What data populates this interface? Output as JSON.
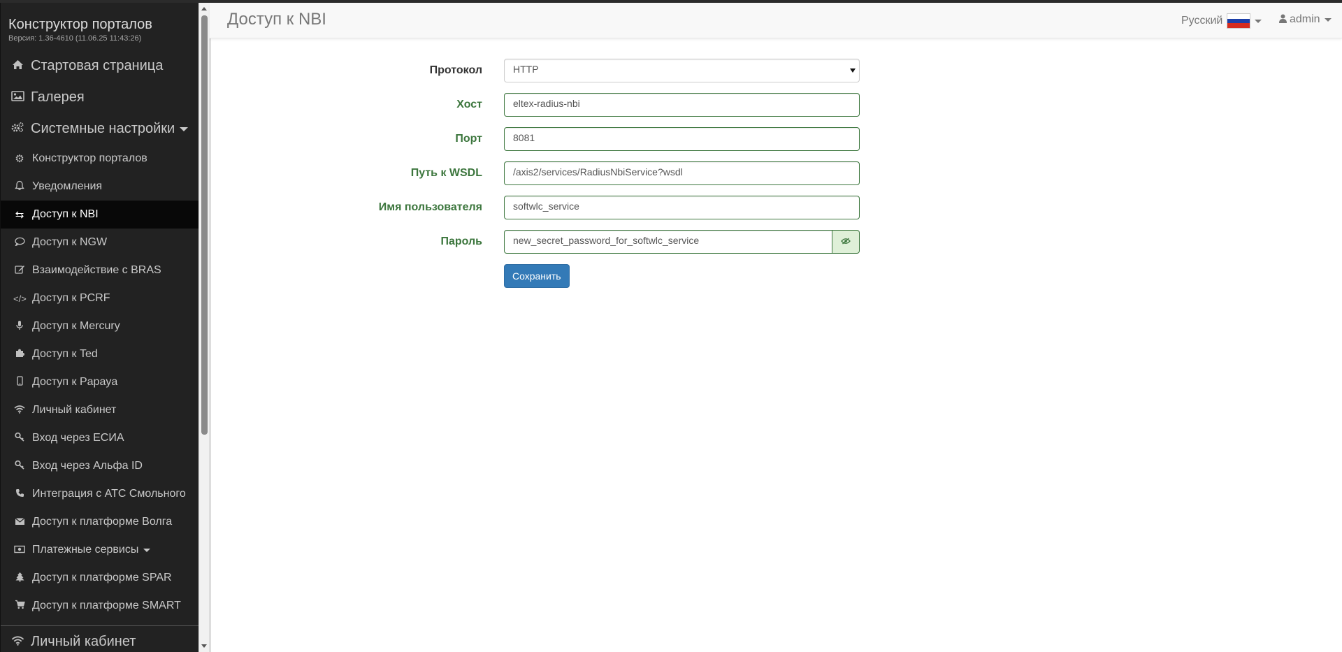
{
  "app": {
    "title": "Конструктор порталов",
    "version": "Версия: 1.36-4610 (11.06.25 11:43:26)"
  },
  "sidebar": {
    "top_items": [
      {
        "label": "Стартовая страница",
        "icon": "home-icon"
      },
      {
        "label": "Галерея",
        "icon": "image-icon"
      },
      {
        "label": "Системные настройки",
        "icon": "cogs-icon"
      }
    ],
    "sub_items": [
      {
        "label": "Конструктор порталов",
        "icon": "gear-icon"
      },
      {
        "label": "Уведомления",
        "icon": "bell-icon"
      },
      {
        "label": "Доступ к NBI",
        "icon": "exchange-icon",
        "active": true
      },
      {
        "label": "Доступ к NGW",
        "icon": "comment-icon"
      },
      {
        "label": "Взаимодействие с BRAS",
        "icon": "edit-icon"
      },
      {
        "label": "Доступ к PCRF",
        "icon": "code-icon"
      },
      {
        "label": "Доступ к Mercury",
        "icon": "microphone-icon"
      },
      {
        "label": "Доступ к Ted",
        "icon": "puzzle-icon"
      },
      {
        "label": "Доступ к Papaya",
        "icon": "mobile-icon"
      },
      {
        "label": "Личный кабинет",
        "icon": "wifi-icon"
      },
      {
        "label": "Вход через ЕСИА",
        "icon": "key-icon"
      },
      {
        "label": "Вход через Альфа ID",
        "icon": "key-icon"
      },
      {
        "label": "Интеграция с АТС Смольного",
        "icon": "phone-icon"
      },
      {
        "label": "Доступ к платформе Волга",
        "icon": "envelope-icon"
      },
      {
        "label": "Платежные сервисы",
        "icon": "money-icon"
      },
      {
        "label": "Доступ к платформе SPAR",
        "icon": "tree-icon"
      },
      {
        "label": "Доступ к платформе SMART",
        "icon": "cart-icon"
      }
    ],
    "bottom_item": {
      "label": "Личный кабинет",
      "icon": "wifi-icon"
    }
  },
  "header": {
    "page_title": "Доступ к NBI",
    "language": "Русский",
    "user": "admin"
  },
  "form": {
    "protocol_label": "Протокол",
    "protocol_value": "HTTP",
    "host_label": "Хост",
    "host_value": "eltex-radius-nbi",
    "port_label": "Порт",
    "port_value": "8081",
    "wsdl_label": "Путь к WSDL",
    "wsdl_value": "/axis2/services/RadiusNbiService?wsdl",
    "username_label": "Имя пользователя",
    "username_value": "softwlc_service",
    "password_label": "Пароль",
    "password_value": "new_secret_password_for_softwlc_service",
    "save_label": "Сохранить"
  },
  "colors": {
    "sidebar_bg": "#222222",
    "active_bg": "#080808",
    "success_green": "#3c763d",
    "primary_blue": "#337ab7"
  }
}
